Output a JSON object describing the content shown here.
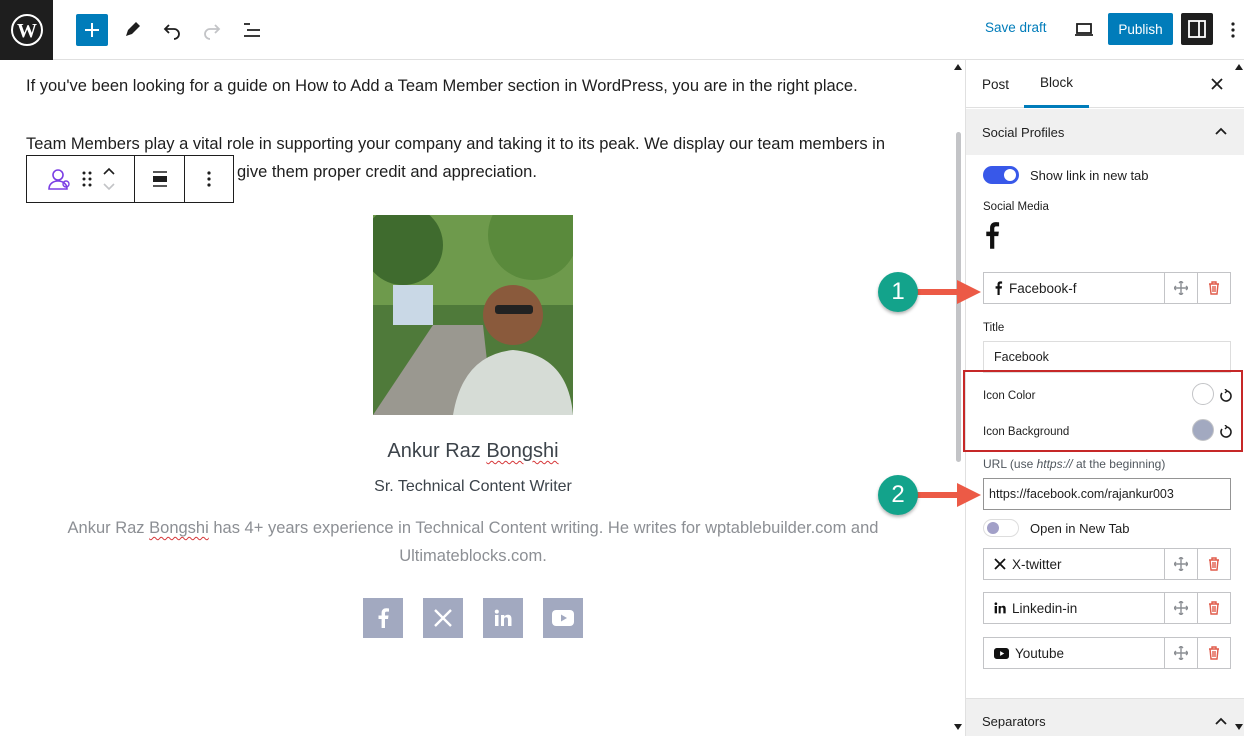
{
  "topbar": {
    "save_draft": "Save draft",
    "publish": "Publish"
  },
  "editor": {
    "para1": "If you've been looking for a guide on How to Add a Team Member section in WordPress, you are in the right place.",
    "para2a": "Team Members play a vital role in supporting your company and taking it to its peak. We display our team members in",
    "para2b": "give them proper credit and appreciation.",
    "member": {
      "name_first": "Ankur Raz ",
      "name_last": "Bongshi",
      "role": "Sr. Technical Content Writer",
      "bio_part1": "Ankur Raz ",
      "bio_squiggle": "Bongshi",
      "bio_part2": " has 4+ years experience in Technical Content writing. He writes for wptablebuilder.com and Ultimateblocks.com."
    },
    "social_icons": [
      "facebook-icon",
      "x-twitter-icon",
      "linkedin-icon",
      "youtube-icon"
    ]
  },
  "sidebar": {
    "tabs": [
      "Post",
      "Block"
    ],
    "panel_title": "Social Profiles",
    "show_link_label": "Show link in new tab",
    "social_media_label": "Social Media",
    "items": [
      {
        "label": "Facebook-f",
        "icon": "facebook-icon"
      },
      {
        "label": "X-twitter",
        "icon": "x-twitter-icon"
      },
      {
        "label": "Linkedin-in",
        "icon": "linkedin-icon"
      },
      {
        "label": "Youtube",
        "icon": "youtube-icon"
      }
    ],
    "title_label": "Title",
    "title_value": "Facebook",
    "icon_color_label": "Icon Color",
    "icon_background_label": "Icon Background",
    "url_label_prefix": "URL (use ",
    "url_label_em": "https://",
    "url_label_suffix": " at the beginning)",
    "url_value": "https://facebook.com/rajankur003",
    "open_new_tab_label": "Open in New Tab",
    "separators_title": "Separators",
    "colors": {
      "icon_color": "#ffffff",
      "icon_background": "#a2a9c0",
      "toggle_on": "#3858e9",
      "accent": "#007cba"
    }
  },
  "annotations": [
    "1",
    "2"
  ]
}
